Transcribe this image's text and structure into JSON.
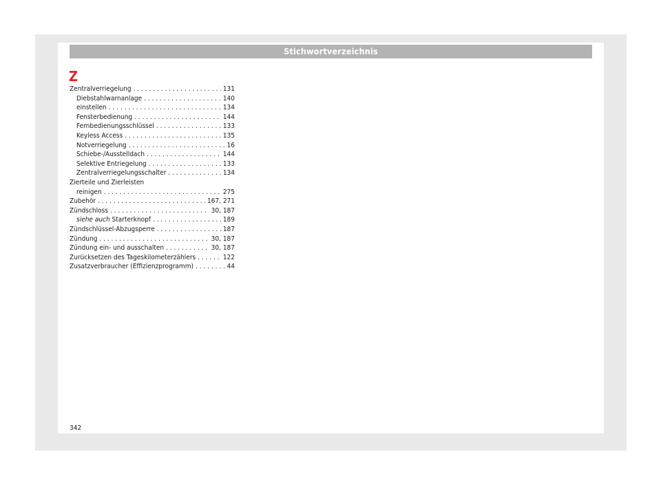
{
  "header": {
    "title": "Stichwortverzeichnis"
  },
  "section_letter": "Z",
  "entries": [
    {
      "term": "Zentralverriegelung",
      "page": "131",
      "level": 0
    },
    {
      "term": "Diebstahlwarnanlage",
      "page": "140",
      "level": 1
    },
    {
      "term": "einstellen",
      "page": "134",
      "level": 1
    },
    {
      "term": "Fensterbedienung",
      "page": "144",
      "level": 1
    },
    {
      "term": "Fernbedienungsschlüssel",
      "page": "133",
      "level": 1
    },
    {
      "term": "Keyless Access",
      "page": "135",
      "level": 1
    },
    {
      "term": "Notverriegelung",
      "page": "16",
      "level": 1
    },
    {
      "term": "Schiebe-/Ausstelldach",
      "page": "144",
      "level": 1
    },
    {
      "term": "Selektive Entriegelung",
      "page": "133",
      "level": 1
    },
    {
      "term": "Zentralverriegelungsschalter",
      "page": "134",
      "level": 1
    },
    {
      "term": "Zierteile und Zierleisten",
      "page": "",
      "level": 0
    },
    {
      "term": "reinigen",
      "page": "275",
      "level": 1
    },
    {
      "term": "Zubehör",
      "page": "167, 271",
      "level": 0
    },
    {
      "term": "Zündschloss",
      "page": "30, 187",
      "level": 0
    },
    {
      "term": "Starterknopf",
      "prefix": "siehe auch",
      "page": "189",
      "level": 1
    },
    {
      "term": "Zündschlüssel-Abzugsperre",
      "page": "187",
      "level": 0
    },
    {
      "term": "Zündung",
      "page": "30, 187",
      "level": 0
    },
    {
      "term": "Zündung ein- und ausschalten",
      "page": "30, 187",
      "level": 0
    },
    {
      "term": "Zurücksetzen des Tageskilometerzählers",
      "page": "122",
      "level": 0
    },
    {
      "term": "Zusatzverbraucher (Effizienzprogramm)",
      "page": "44",
      "level": 0
    }
  ],
  "footer": {
    "page_number": "342"
  },
  "colors": {
    "accent": "#e0262b",
    "header_bg": "#b3b3b3",
    "frame_bg": "#eae9e9"
  }
}
